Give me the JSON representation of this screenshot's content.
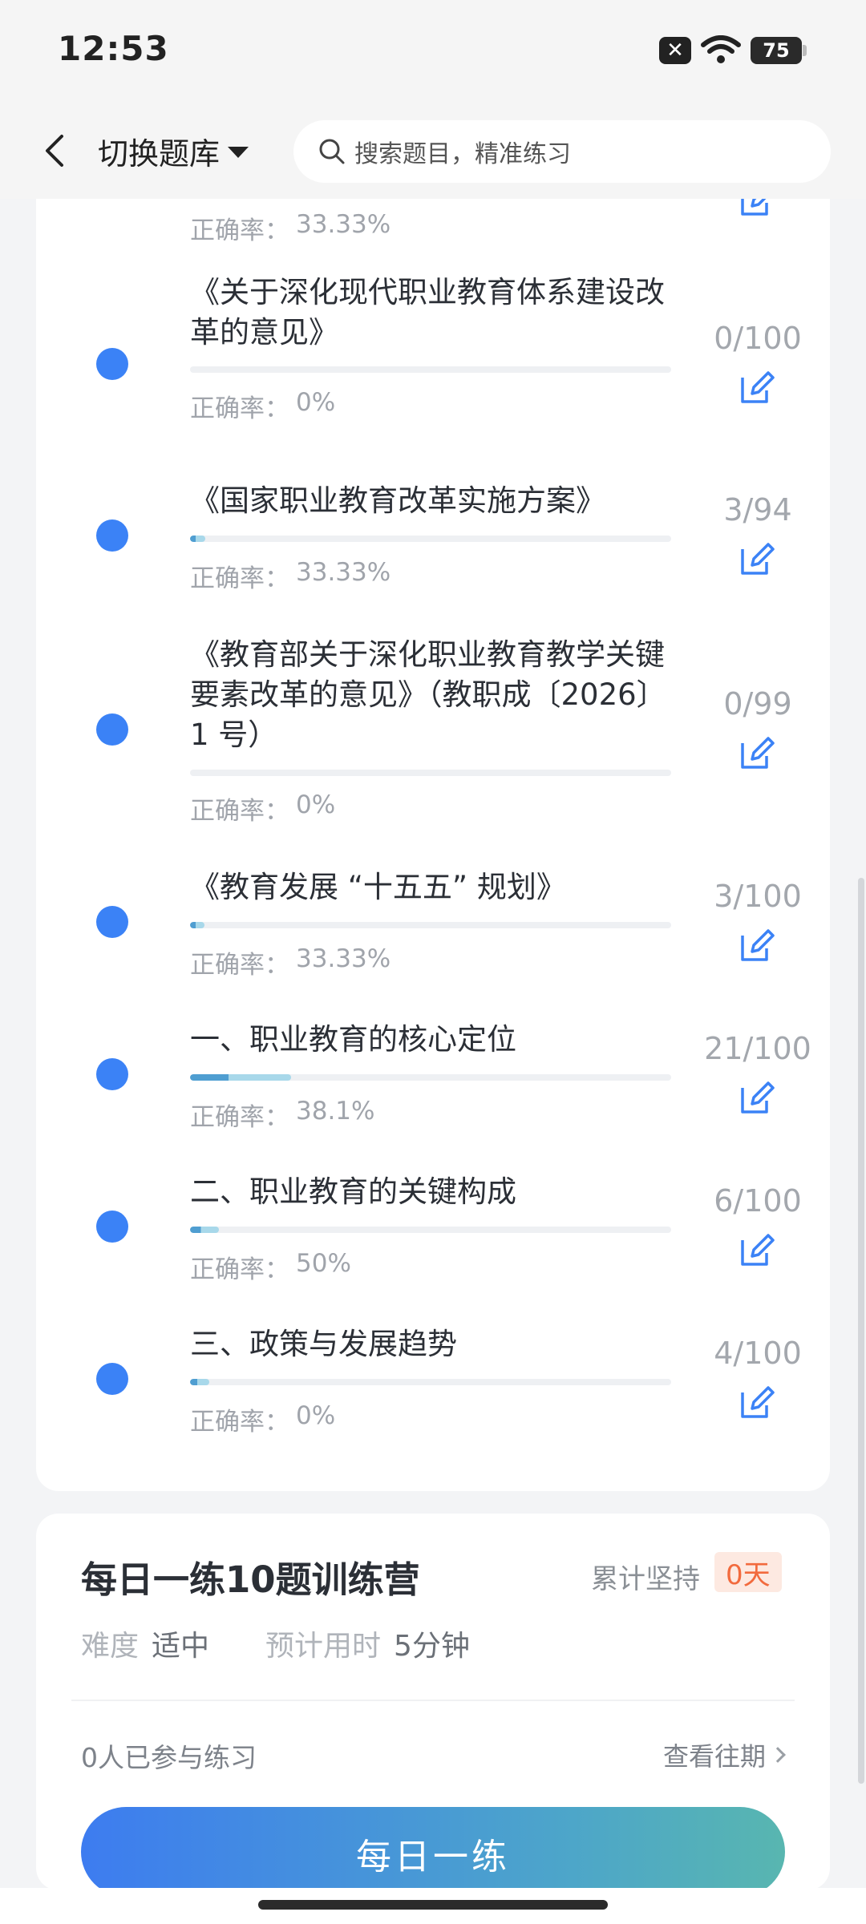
{
  "status": {
    "time": "12:53",
    "battery": "75"
  },
  "header": {
    "switch_label": "切换题库",
    "search_placeholder": "搜索题目，精准练习"
  },
  "accuracy_label": "正确率：",
  "top_partial": {
    "accuracy": "33.33%"
  },
  "items": [
    {
      "title": "《关于深化现代职业教育体系建设改革的意见》",
      "count": "0/100",
      "accuracy": "0%",
      "progress": 0
    },
    {
      "title": "《国家职业教育改革实施方案》",
      "count": "3/94",
      "accuracy": "33.33%",
      "progress": 0.032
    },
    {
      "title": "《教育部关于深化职业教育教学关键要素改革的意见》（教职成〔2026〕1 号）",
      "count": "0/99",
      "accuracy": "0%",
      "progress": 0
    },
    {
      "title": "《教育发展 “十五五” 规划》",
      "count": "3/100",
      "accuracy": "33.33%",
      "progress": 0.03
    },
    {
      "title": "一、职业教育的核心定位",
      "count": "21/100",
      "accuracy": "38.1%",
      "progress": 0.21
    },
    {
      "title": "二、职业教育的关键构成",
      "count": "6/100",
      "accuracy": "50%",
      "progress": 0.06
    },
    {
      "title": "三、政策与发展趋势",
      "count": "4/100",
      "accuracy": "0%",
      "progress": 0.04
    }
  ],
  "daily": {
    "title": "每日一练10题训练营",
    "streak_label": "累计坚持",
    "streak_value": "0天",
    "difficulty_label": "难度",
    "difficulty_value": "适中",
    "time_label": "预计用时",
    "time_value": "5分钟",
    "participants": "0人已参与练习",
    "history_link": "查看往期",
    "button_label": "每日一练"
  },
  "colors": {
    "accent": "#3b82f6",
    "streak": "#f26a3d"
  }
}
